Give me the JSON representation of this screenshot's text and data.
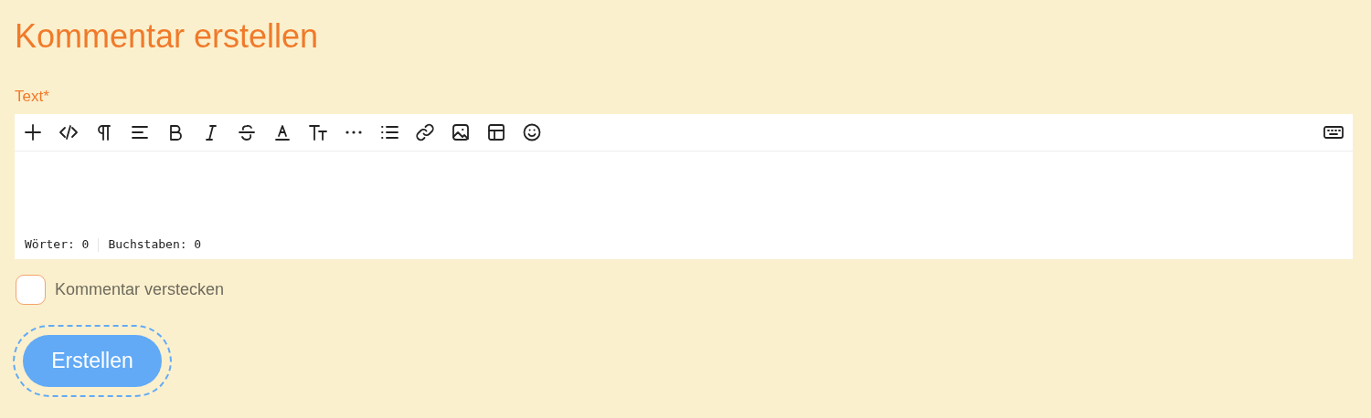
{
  "title": "Kommentar erstellen",
  "field": {
    "label": "Text*",
    "counts": [
      "Wörter: 0",
      "Buchstaben: 0"
    ]
  },
  "hide_comment": {
    "label": "Kommentar verstecken",
    "checked": false
  },
  "submit": {
    "label": "Erstellen",
    "focused": true
  }
}
